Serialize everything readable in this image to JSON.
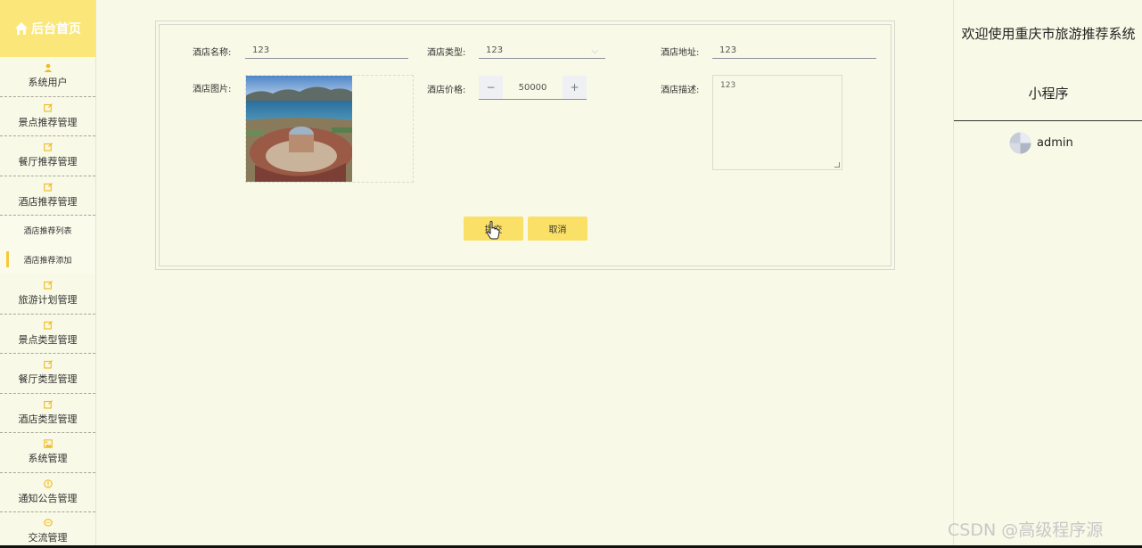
{
  "sidebar": {
    "home_label": "后台首页",
    "items": [
      {
        "label": "系统用户",
        "icon": "user-icon"
      },
      {
        "label": "景点推荐管理",
        "icon": "edit-icon"
      },
      {
        "label": "餐厅推荐管理",
        "icon": "edit-icon"
      },
      {
        "label": "酒店推荐管理",
        "icon": "edit-icon"
      },
      {
        "label": "旅游计划管理",
        "icon": "edit-icon"
      },
      {
        "label": "景点类型管理",
        "icon": "edit-icon"
      },
      {
        "label": "餐厅类型管理",
        "icon": "edit-icon"
      },
      {
        "label": "酒店类型管理",
        "icon": "edit-icon"
      },
      {
        "label": "系统管理",
        "icon": "picture-icon"
      },
      {
        "label": "通知公告管理",
        "icon": "info-icon"
      },
      {
        "label": "交流管理",
        "icon": "chat-icon"
      }
    ],
    "sub_items": [
      {
        "label": "酒店推荐列表",
        "active": false
      },
      {
        "label": "酒店推荐添加",
        "active": true
      }
    ]
  },
  "form": {
    "name": {
      "label": "酒店名称:",
      "value": "123"
    },
    "type": {
      "label": "酒店类型:",
      "value": "123"
    },
    "address": {
      "label": "酒店地址:",
      "value": "123"
    },
    "image": {
      "label": "酒店图片:"
    },
    "price": {
      "label": "酒店价格:",
      "value": "50000",
      "minus": "−",
      "plus": "+"
    },
    "description": {
      "label": "酒店描述:",
      "value": "123"
    },
    "submit_label": "提交",
    "cancel_label": "取消"
  },
  "header": {
    "welcome": "欢迎使用重庆市旅游推荐系统",
    "subtitle": "小程序",
    "username": "admin"
  },
  "watermark": "CSDN @高级程序源",
  "colors": {
    "background": "#f8f9e6",
    "accent": "#fbe067",
    "home_bar": "#fbe67a",
    "active_marker": "#f7c83e"
  }
}
